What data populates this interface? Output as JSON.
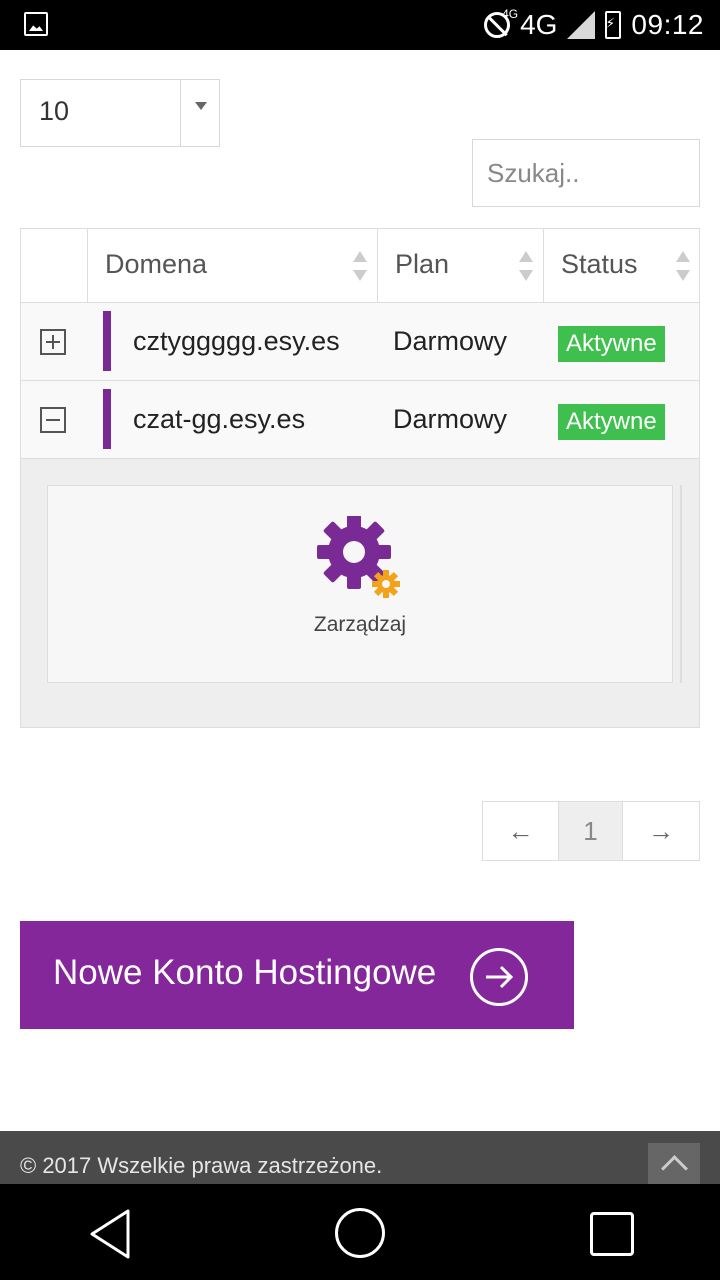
{
  "status_bar": {
    "network": "4G",
    "network_small": "4G",
    "time": "09:12"
  },
  "controls": {
    "page_size": "10",
    "search_placeholder": "Szukaj.."
  },
  "table": {
    "headers": [
      "",
      "Domena",
      "Plan",
      "Status"
    ],
    "rows": [
      {
        "domain": "cztyggggg.esy.es",
        "plan": "Darmowy",
        "status": "Aktywne",
        "expanded": false
      },
      {
        "domain": "czat-gg.esy.es",
        "plan": "Darmowy",
        "status": "Aktywne",
        "expanded": true
      }
    ],
    "detail": {
      "manage_label": "Zarządzaj"
    }
  },
  "pagination": {
    "prev": "←",
    "current": "1",
    "next": "→"
  },
  "cta": {
    "label": "Nowe Konto Hostingowe"
  },
  "footer": {
    "copyright": "© 2017 Wszelkie prawa zastrzeżone."
  },
  "colors": {
    "brand_purple": "#84279a",
    "status_green": "#3fbf4e",
    "gear_orange": "#f2a31b"
  }
}
